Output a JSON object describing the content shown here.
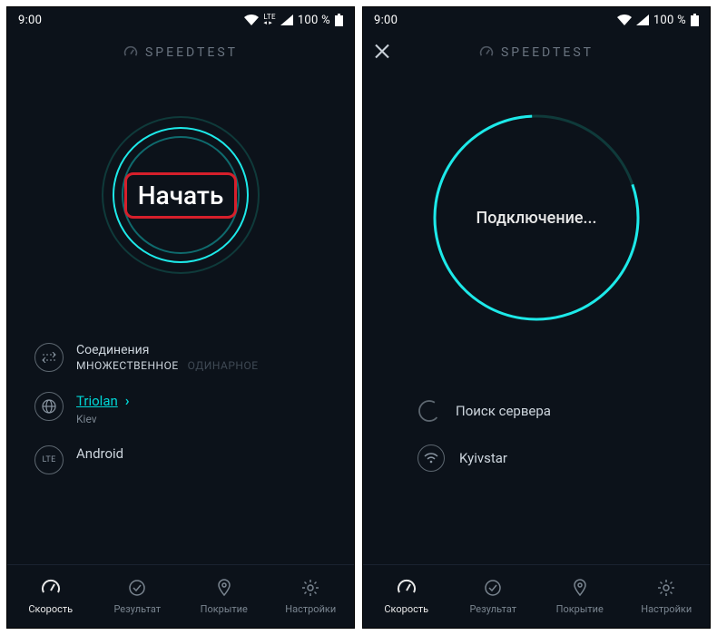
{
  "left": {
    "status": {
      "time": "9:00",
      "battery": "100 %",
      "lte_label": "LTE"
    },
    "brand": "SPEEDTEST",
    "go_label": "Начать",
    "connections": {
      "title": "Соединения",
      "multi": "МНОЖЕСТВЕННОЕ",
      "single": "ОДИНАРНОЕ"
    },
    "server": {
      "name": "Triolan",
      "city": "Kiev"
    },
    "network": {
      "type": "LTE",
      "carrier": "Android"
    },
    "nav": {
      "speed": "Скорость",
      "result": "Результат",
      "coverage": "Покрытие",
      "settings": "Настройки"
    }
  },
  "right": {
    "status": {
      "time": "9:00",
      "battery": "100 %"
    },
    "brand": "SPEEDTEST",
    "connecting": "Подключение...",
    "search": "Поиск сервера",
    "carrier": "Kyivstar",
    "nav": {
      "speed": "Скорость",
      "result": "Результат",
      "coverage": "Покрытие",
      "settings": "Настройки"
    }
  }
}
